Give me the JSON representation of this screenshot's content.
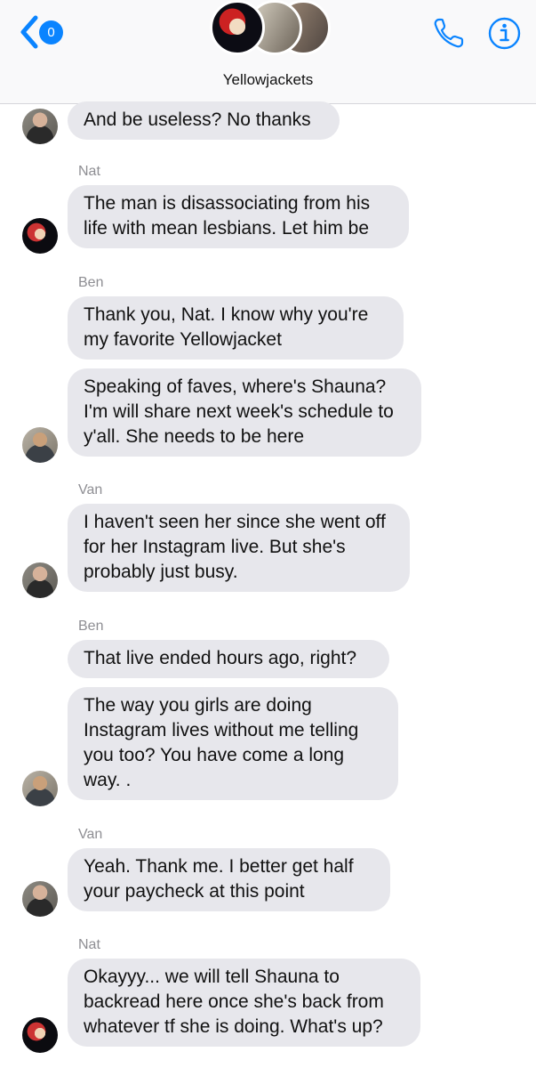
{
  "header": {
    "back_badge": "0",
    "title": "Yellowjackets",
    "icons": [
      "back-chevron-icon",
      "phone-icon",
      "info-icon"
    ],
    "accent": "#0a84ff"
  },
  "messages": [
    {
      "text": "And be useless? No thanks"
    },
    {
      "sender": "Nat",
      "text": "The man is disassociating from his life with mean lesbians. Let him be"
    },
    {
      "sender": "Ben",
      "text": "Thank you, Nat. I know why you're my favorite Yellowjacket"
    },
    {
      "text": "Speaking of faves, where's Shauna? I'm will share next week's schedule to y'all. She needs to be here"
    },
    {
      "sender": "Van",
      "text": "I haven't seen her since she went off for her Instagram live. But she's probably just busy."
    },
    {
      "sender": "Ben",
      "text": "That live ended hours ago, right?"
    },
    {
      "text": "The way you girls are doing Instagram lives without me telling you too? You have come a long way. ."
    },
    {
      "sender": "Van",
      "text": "Yeah. Thank me. I better get half your paycheck at this point"
    },
    {
      "sender": "Nat",
      "text": "Okayyy... we will tell Shauna to backread here once she's back from whatever tf she is doing. What's up?"
    }
  ],
  "colors": {
    "bubble": "#e7e7ec",
    "sender_label": "#8e8e93",
    "header_bg": "#f9f9fa"
  }
}
